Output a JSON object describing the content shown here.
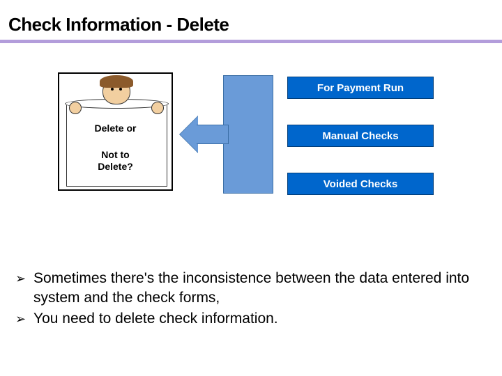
{
  "title": "Check Information - Delete",
  "cartoon": {
    "line1": "Delete or",
    "line2": "Not to\nDelete?"
  },
  "labels": {
    "box1": "For Payment Run",
    "box2": "Manual Checks",
    "box3": "Voided Checks"
  },
  "bullets": {
    "marker": "➢",
    "item1": "Sometimes there's the inconsistence between the data entered into system and the check forms,",
    "item2": "You need to delete check information."
  }
}
